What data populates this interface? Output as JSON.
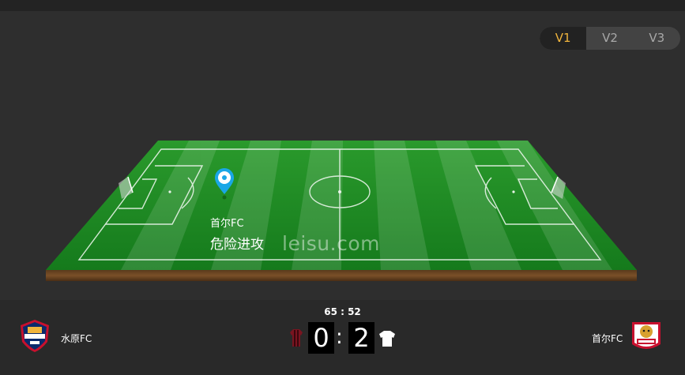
{
  "version_tabs": [
    {
      "label": "V1",
      "active": true
    },
    {
      "label": "V2",
      "active": false
    },
    {
      "label": "V3",
      "active": false
    }
  ],
  "event": {
    "team": "首尔FC",
    "text": "危险进攻",
    "icon": "ball-marker-icon"
  },
  "watermark": "leisu.com",
  "match": {
    "time": "65 : 52",
    "home_score": "0",
    "away_score": "2",
    "separator": ":"
  },
  "home_team": {
    "name": "水原FC",
    "logo": "suwon-fc-logo"
  },
  "away_team": {
    "name": "首尔FC",
    "logo": "seoul-fc-logo"
  },
  "colors": {
    "accent": "#f0b43c",
    "pitch_green": "#1e8c28",
    "marker_blue": "#1aa7e6"
  }
}
